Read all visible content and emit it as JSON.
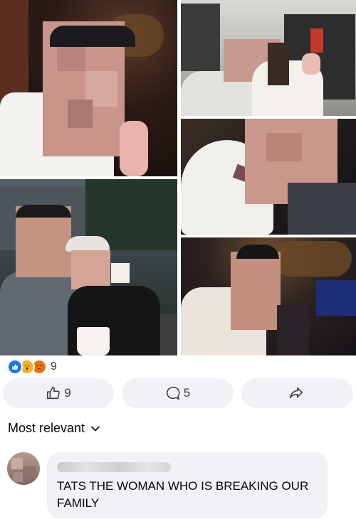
{
  "post": {
    "photos": [
      {
        "description_name": "selfie-bar"
      },
      {
        "description_name": "couple-wine-shelf"
      },
      {
        "description_name": "couple-street-drinks"
      },
      {
        "description_name": "closeup-cap"
      },
      {
        "description_name": "selfie-lounge"
      }
    ],
    "reactions": {
      "icons": [
        "like-icon",
        "wow-icon",
        "angry-icon"
      ],
      "count": "9",
      "colors": {
        "like": "#1877f2",
        "wow": "#f7b125",
        "angry": "#e9710f"
      }
    },
    "actions": {
      "like_count": "9",
      "comment_count": "5"
    }
  },
  "comments": {
    "sort_label": "Most relevant",
    "items": [
      {
        "text": "TATS THE WOMAN WHO IS BREAKING OUR FAMILY"
      }
    ]
  }
}
